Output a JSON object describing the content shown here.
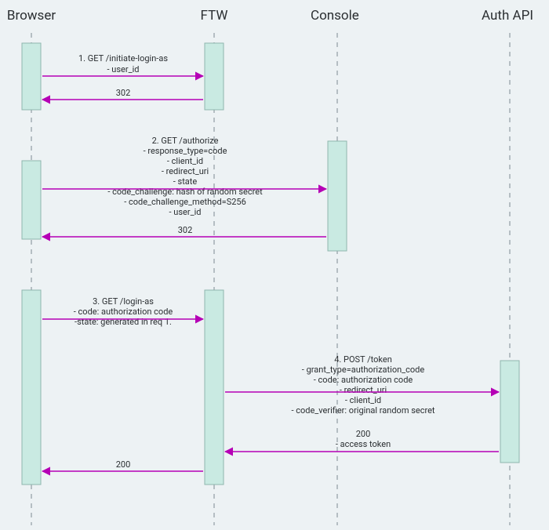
{
  "participants": {
    "browser": "Browser",
    "ftw": "FTW",
    "console": "Console",
    "authapi": "Auth API"
  },
  "messages": {
    "m1": {
      "l1": "1. GET /initiate-login-as",
      "l2": "- user_id",
      "resp": "302"
    },
    "m2": {
      "l1": "2. GET /authorize",
      "l2": "- response_type=code",
      "l3": "- client_id",
      "l4": "- redirect_uri",
      "l5": "- state",
      "l6": "- code_challenge: hash of random secret",
      "l7": "- code_challenge_method=S256",
      "l8": "- user_id",
      "resp": "302"
    },
    "m3": {
      "l1": "3. GET /login-as",
      "l2": "- code: authorization code",
      "l3": "-state: generated in req 1."
    },
    "m4": {
      "l1": "4. POST /token",
      "l2": "- grant_type=authorization_code",
      "l3": "- code: authorization code",
      "l4": "- redirect_uri",
      "l5": "- client_id",
      "l6": "- code_verifier: original random secret",
      "resp1": "200",
      "resp2": "- access token"
    },
    "m5": {
      "resp": "200"
    }
  }
}
